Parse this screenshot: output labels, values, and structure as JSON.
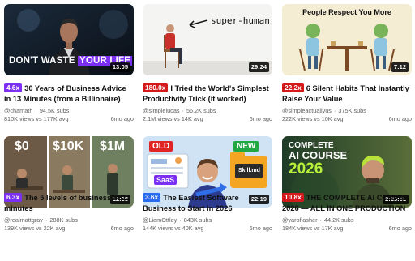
{
  "colors": {
    "multiplier_purple": "#7b2ff2",
    "multiplier_red": "#d41a1a",
    "multiplier_blue": "#2a6cf0",
    "text_secondary": "#606060"
  },
  "videos": [
    {
      "multiplier": "4.6x",
      "multiplier_color": "#7b2ff2",
      "title": "30 Years of Business Advice in 13 Minutes (from a Billionaire)",
      "handle": "@chamath",
      "subs": "94.5K subs",
      "stats": "810K views vs 177K avg",
      "age": "6mo ago",
      "duration": "13:05",
      "thumb_text": {
        "line1a": "DON'T WASTE ",
        "line1b": "YOUR LIFE"
      }
    },
    {
      "multiplier": "180.0x",
      "multiplier_color": "#d41a1a",
      "title": "I Tried the World's Simplest Productivity Trick (it worked)",
      "handle": "@simplelucas",
      "subs": "56.2K subs",
      "stats": "2.1M views vs 14K avg",
      "age": "6mo ago",
      "duration": "29:24",
      "thumb_text": {
        "caption": "super-human"
      }
    },
    {
      "multiplier": "22.2x",
      "multiplier_color": "#d41a1a",
      "title": "6 Silent Habits That Instantly Raise Your Value",
      "handle": "@simpleactuallyus",
      "subs": "375K subs",
      "stats": "222K views vs 10K avg",
      "age": "6mo ago",
      "duration": "7:12",
      "thumb_text": {
        "caption": "People Respect You More"
      }
    },
    {
      "multiplier": "6.3x",
      "multiplier_color": "#7b2ff2",
      "title": "The 5 levels of business in 12 minutes",
      "handle": "@realmattgray",
      "subs": "288K subs",
      "stats": "139K views vs 22K avg",
      "age": "6mo ago",
      "duration": "12:38",
      "thumb_text": {
        "a": "$0",
        "b": "$10K",
        "c": "$1M"
      }
    },
    {
      "multiplier": "3.6x",
      "multiplier_color": "#2a6cf0",
      "title": "The Easiest Software Business to Start in 2026",
      "handle": "@LiamOttley",
      "subs": "843K subs",
      "stats": "144K views vs 40K avg",
      "age": "6mo ago",
      "duration": "22:19",
      "thumb_text": {
        "old": "OLD",
        "new": "NEW",
        "saas": "SaaS",
        "skill": "Skill.md"
      }
    },
    {
      "multiplier": "10.8x",
      "multiplier_color": "#d41a1a",
      "title": "THE COMPLETE AI COURSE 2026 — ALL IN ONE PRODUCTION",
      "handle": "@yaroflasher",
      "subs": "44.2K subs",
      "stats": "184K views vs 17K avg",
      "age": "6mo ago",
      "duration": "2:23:51",
      "thumb_text": {
        "line1": "COMPLETE",
        "line2": "AI COURSE",
        "line3": "2026"
      }
    }
  ]
}
